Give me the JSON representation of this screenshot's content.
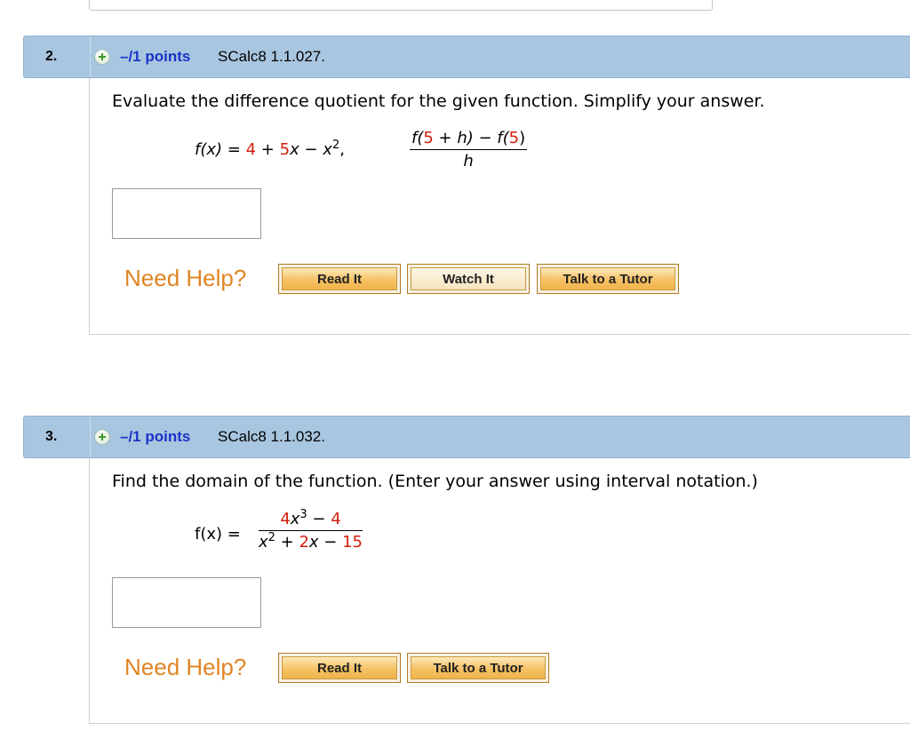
{
  "questions": [
    {
      "number": "2.",
      "points": "–/1 points",
      "code": "SCalc8 1.1.027.",
      "prompt": "Evaluate the difference quotient for the given function. Simplify your answer.",
      "function_lhs": "f(x)",
      "function_parts": [
        "=",
        "4",
        "+",
        "5",
        "x",
        "−",
        "x",
        "2",
        ","
      ],
      "quotient": {
        "numerator": [
          "f(",
          "5",
          " + h) − f(",
          "5",
          ")"
        ],
        "denominator": "h"
      },
      "need_help": "Need Help?",
      "buttons": [
        "Read It",
        "Watch It",
        "Talk to a Tutor"
      ]
    },
    {
      "number": "3.",
      "points": "–/1 points",
      "code": "SCalc8 1.1.032.",
      "prompt": "Find the domain of the function. (Enter your answer using interval notation.)",
      "function_lhs": "f(x)  =",
      "fraction": {
        "numerator": [
          "4",
          "x",
          "3",
          " − ",
          "4"
        ],
        "denominator": [
          "x",
          "2",
          " + ",
          "2",
          "x",
          " − ",
          "15"
        ]
      },
      "need_help": "Need Help?",
      "buttons": [
        "Read It",
        "Talk to a Tutor"
      ]
    }
  ],
  "colors": {
    "header_bg": "#a9c6e0",
    "points_blue": "#1a34c8",
    "math_red": "#d0200c",
    "help_orange": "#e08524",
    "button_gold": "#f6c165"
  },
  "icons": [
    "plus-icon"
  ]
}
